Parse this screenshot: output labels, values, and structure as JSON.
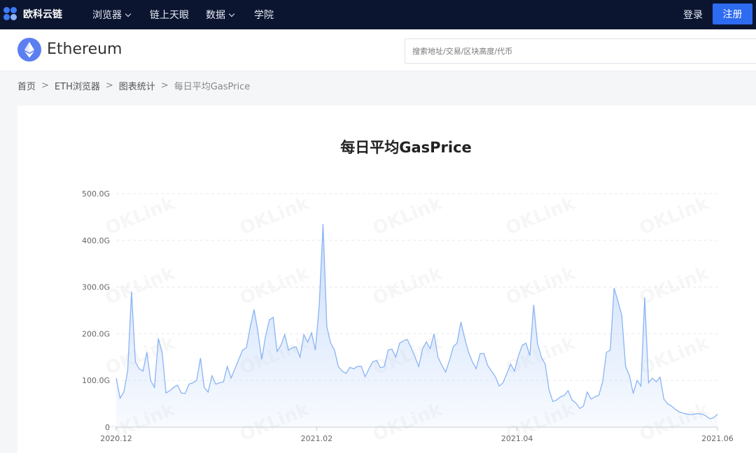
{
  "nav": {
    "logo_text": "欧科云链",
    "items": [
      {
        "label": "浏览器",
        "dropdown": true
      },
      {
        "label": "链上天眼",
        "dropdown": false
      },
      {
        "label": "数据",
        "dropdown": true
      },
      {
        "label": "学院",
        "dropdown": false
      }
    ],
    "login": "登录",
    "register": "注册"
  },
  "header": {
    "title": "Ethereum",
    "search_placeholder": "搜索地址/交易/区块高度/代币"
  },
  "breadcrumb": [
    "首页",
    "ETH浏览器",
    "图表统计",
    "每日平均GasPrice"
  ],
  "breadcrumb_separator": ">",
  "watermark": "OKLink",
  "colors": {
    "nav_bg": "#0b1530",
    "accent": "#2d6bf0",
    "line": "#8ab4f5",
    "fill_top": "#c7dbfb"
  },
  "chart_data": {
    "type": "area",
    "title": "每日平均GasPrice",
    "y_ticks": [
      "0",
      "100.0G",
      "200.0G",
      "300.0G",
      "400.0G",
      "500.0G"
    ],
    "ylim": [
      0,
      500
    ],
    "x_ticks": [
      "2020.12",
      "2021.02",
      "2021.04",
      "2021.06"
    ],
    "grid": true,
    "unit": "G",
    "series": [
      {
        "values": [
          105,
          62,
          75,
          120,
          290,
          140,
          125,
          120,
          160,
          100,
          85,
          190,
          160,
          73,
          78,
          85,
          90,
          73,
          72,
          92,
          95,
          100,
          148,
          85,
          75,
          110,
          92,
          95,
          97,
          130,
          105,
          125,
          145,
          165,
          170,
          215,
          252,
          205,
          145,
          195,
          230,
          235,
          162,
          175,
          198,
          165,
          170,
          172,
          150,
          198,
          182,
          202,
          165,
          260,
          435,
          215,
          180,
          165,
          130,
          120,
          115,
          128,
          125,
          130,
          130,
          108,
          125,
          140,
          143,
          127,
          130,
          165,
          167,
          150,
          180,
          185,
          188,
          170,
          150,
          130,
          168,
          183,
          168,
          200,
          150,
          133,
          118,
          142,
          172,
          180,
          225,
          190,
          160,
          140,
          125,
          157,
          158,
          132,
          120,
          108,
          88,
          95,
          115,
          135,
          120,
          152,
          175,
          180,
          153,
          262,
          180,
          150,
          135,
          80,
          55,
          58,
          65,
          68,
          78,
          58,
          52,
          40,
          45,
          75,
          60,
          65,
          68,
          97,
          160,
          165,
          298,
          270,
          240,
          130,
          110,
          72,
          100,
          88,
          278,
          95,
          105,
          97,
          107,
          60,
          50,
          45,
          38,
          33,
          30,
          28,
          27,
          28,
          29,
          28,
          24,
          18,
          20,
          28
        ]
      }
    ]
  }
}
